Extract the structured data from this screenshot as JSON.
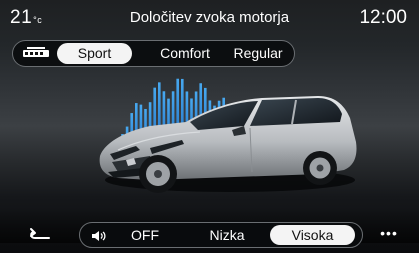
{
  "status": {
    "temperature": "21",
    "temperature_unit": "°c",
    "title": "Določitev zvoka motorja",
    "time": "12:00"
  },
  "sound_mode": {
    "icon": "sound-profile-icon",
    "options": [
      "Sport",
      "Comfort",
      "Regular"
    ],
    "selected": "Sport"
  },
  "volume": {
    "icon": "speaker-icon",
    "options": [
      "OFF",
      "Nizka",
      "Visoka"
    ],
    "selected": "Visoka"
  },
  "nav": {
    "back_icon": "back-arrow-icon",
    "more_label": "•••"
  },
  "colors": {
    "accent_blue": "#2b8fe0",
    "selected_bg": "#f4f4f4"
  }
}
